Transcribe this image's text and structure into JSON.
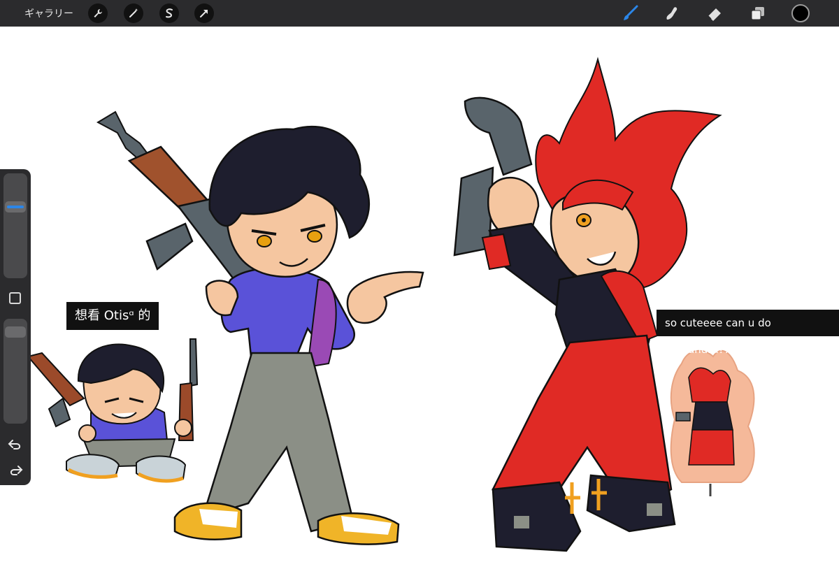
{
  "app": {
    "gallery_label": "ギャラリー"
  },
  "toolbar": {
    "left_tools": [
      "wrench-icon",
      "magic-wand-icon",
      "selection-icon",
      "transform-arrow-icon"
    ],
    "right_tools": [
      "brush-icon",
      "smudge-icon",
      "eraser-icon",
      "layers-icon"
    ],
    "active_tool": "brush-icon",
    "active_color": "#2b86e8",
    "current_color": "#000000"
  },
  "sidebar": {
    "brush_size_level": 0.3,
    "opacity_level": 0.08,
    "icons": [
      "modify-square-icon",
      "undo-icon",
      "redo-icon"
    ]
  },
  "canvas": {
    "caption_left": "想看 Otisᵅ 的",
    "caption_right": "so cuteeee can u do cassandra??"
  },
  "colors": {
    "toolbar_bg": "#2b2b2d",
    "hair_black": "#1e1e2e",
    "jacket_blue": "#5a52d8",
    "pants_grey": "#8b8f86",
    "skin": "#f5c6a0",
    "red": "#e02a25",
    "shoe_yellow": "#f0b428"
  }
}
